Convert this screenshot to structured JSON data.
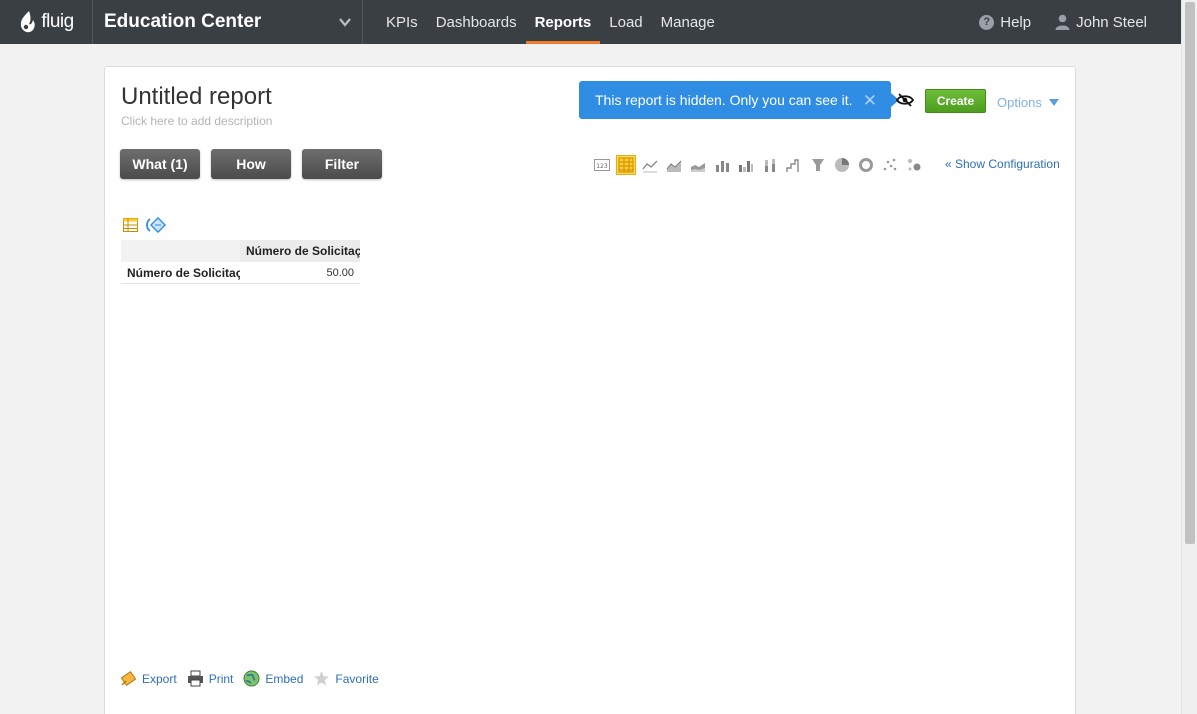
{
  "header": {
    "logo_text": "fluig",
    "app_name": "Education Center",
    "nav": [
      {
        "label": "KPIs"
      },
      {
        "label": "Dashboards"
      },
      {
        "label": "Reports"
      },
      {
        "label": "Load"
      },
      {
        "label": "Manage"
      }
    ],
    "active_nav": "Reports",
    "help_label": "Help",
    "user_name": "John Steel"
  },
  "report": {
    "title": "Untitled report",
    "description_placeholder": "Click here to add description",
    "hidden_notice": "This report is hidden. Only you can see it.",
    "create_label": "Create",
    "options_label": "Options",
    "tabs": {
      "what": "What (1)",
      "how": "How",
      "filter": "Filter"
    },
    "show_configuration": "« Show Configuration",
    "chart_types": [
      "number-icon",
      "table-icon",
      "line-icon",
      "area-icon",
      "stacked-area-icon",
      "bar-icon",
      "grouped-bar-icon",
      "column-icon",
      "step-icon",
      "funnel-icon",
      "pie-icon",
      "donut-icon",
      "scatter-icon",
      "bubble-icon"
    ],
    "active_chart_type": "table-icon"
  },
  "table": {
    "column_header": "Número de Solicitaç",
    "row_header": "Número de Solicitaç",
    "value": "50.00"
  },
  "footer": {
    "export": "Export",
    "print": "Print",
    "embed": "Embed",
    "favorite": "Favorite"
  },
  "colors": {
    "topbar": "#3a3f44",
    "accent": "#f07a2c",
    "notice": "#2f8de4",
    "create": "#5aac2a",
    "link": "#2f6fb7"
  }
}
